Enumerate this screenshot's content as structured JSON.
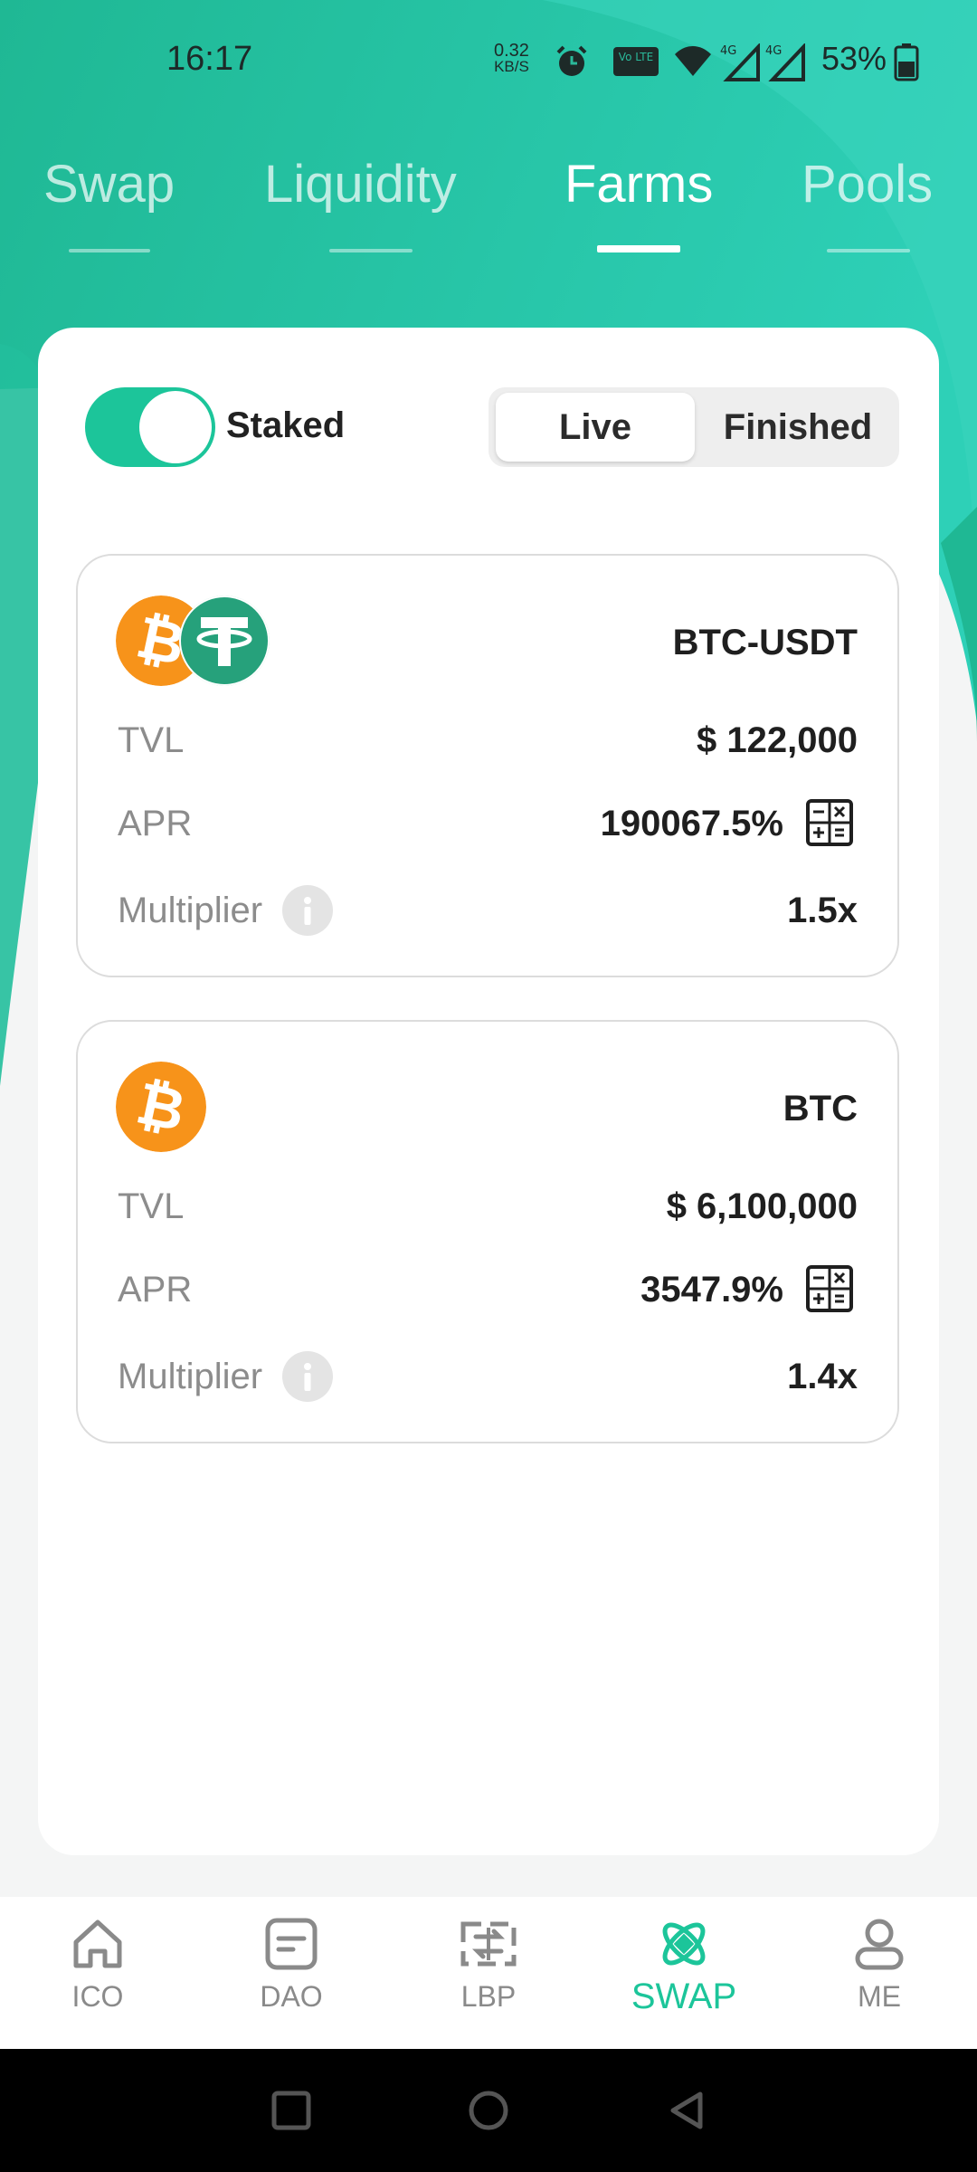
{
  "status_bar": {
    "time": "16:17",
    "net_speed_value": "0.32",
    "net_speed_unit": "KB/S",
    "lte_label": "Vo LTE",
    "signal_1_label": "4G",
    "signal_2_label": "4G",
    "battery": "53%",
    "icons": [
      "alarm-icon",
      "volte-icon",
      "wifi-icon",
      "signal-4g-icon",
      "signal-4g-icon",
      "battery-icon"
    ]
  },
  "tabs": [
    {
      "label": "Swap",
      "active": false
    },
    {
      "label": "Liquidity",
      "active": false
    },
    {
      "label": "Farms",
      "active": true
    },
    {
      "label": "Pools",
      "active": false
    }
  ],
  "controls": {
    "staked_label": "Staked",
    "staked_on": true,
    "segment": {
      "live": "Live",
      "finished": "Finished",
      "selected": "Live"
    }
  },
  "farms": [
    {
      "name": "BTC-USDT",
      "tokens": [
        "bitcoin-icon",
        "tether-icon"
      ],
      "tvl_label": "TVL",
      "tvl": "$ 122,000",
      "apr_label": "APR",
      "apr": "190067.5%",
      "multiplier_label": "Multiplier",
      "multiplier": "1.5x"
    },
    {
      "name": "BTC",
      "tokens": [
        "bitcoin-icon"
      ],
      "tvl_label": "TVL",
      "tvl": "$ 6,100,000",
      "apr_label": "APR",
      "apr": "3547.9%",
      "multiplier_label": "Multiplier",
      "multiplier": "1.4x"
    }
  ],
  "bottom_nav": [
    {
      "label": "ICO",
      "icon": "home-icon",
      "active": false
    },
    {
      "label": "DAO",
      "icon": "document-icon",
      "active": false
    },
    {
      "label": "LBP",
      "icon": "exchange-icon",
      "active": false
    },
    {
      "label": "SWAP",
      "icon": "swap-icon",
      "active": true
    },
    {
      "label": "ME",
      "icon": "user-icon",
      "active": false
    }
  ],
  "colors": {
    "accent": "#1cc59a",
    "header_gradient_start": "#1fb894",
    "header_gradient_end": "#2ed0b7",
    "bitcoin": "#f7931a",
    "tether": "#26a17b"
  }
}
